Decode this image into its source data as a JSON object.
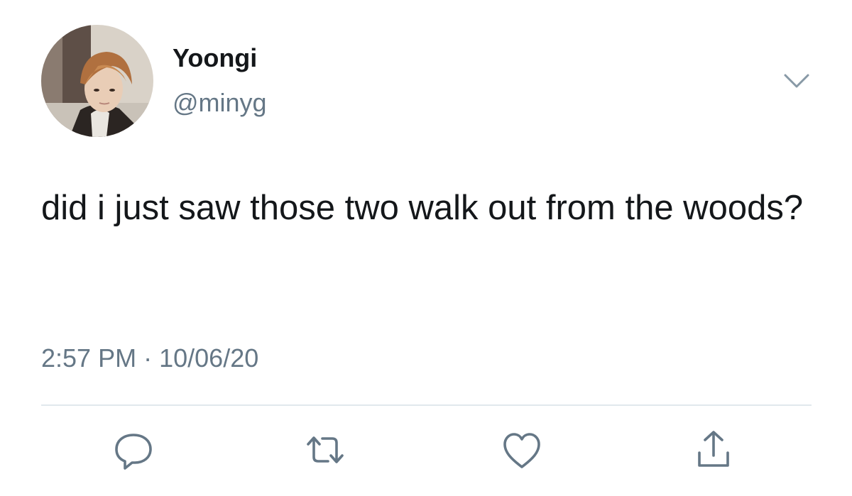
{
  "user": {
    "display_name": "Yoongi",
    "handle": "@minyg"
  },
  "tweet": {
    "text": "did i just saw those two walk out from the woods?",
    "time": "2:57 PM",
    "separator": "·",
    "date": "10/06/20"
  },
  "actions": {
    "reply_icon": "reply-icon",
    "retweet_icon": "retweet-icon",
    "like_icon": "heart-icon",
    "share_icon": "share-icon"
  },
  "colors": {
    "text_primary": "#14171a",
    "text_secondary": "#657786",
    "divider": "#e1e8ed",
    "icon": "#657786"
  }
}
